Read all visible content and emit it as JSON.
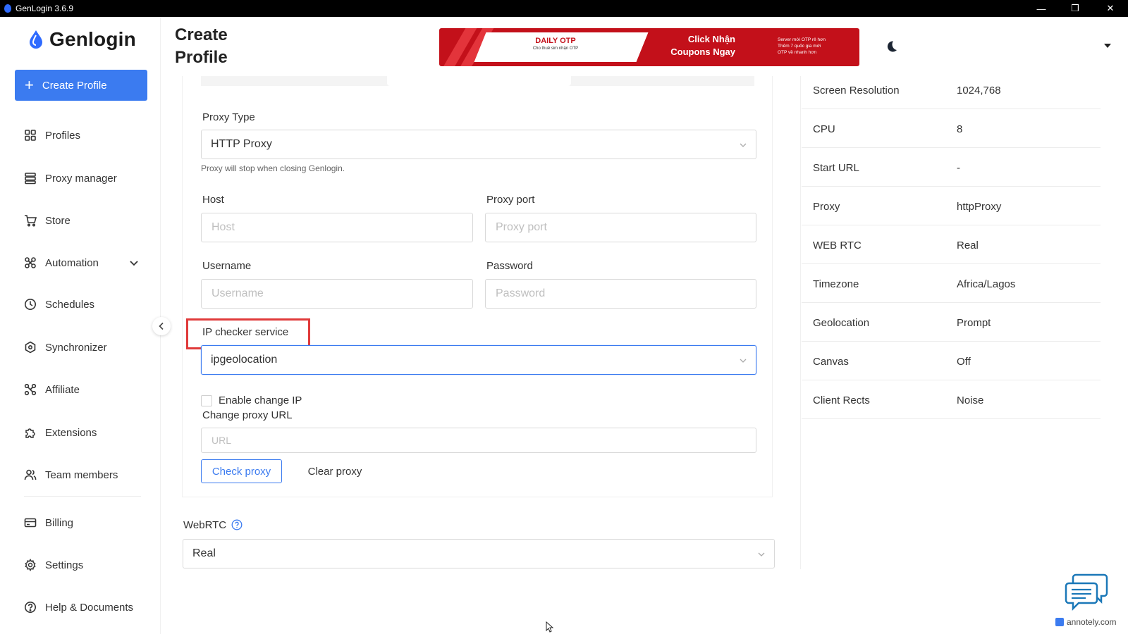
{
  "window": {
    "title": "GenLogin 3.6.9"
  },
  "brand": {
    "name": "Genlogin",
    "accent": "#3b7bf0"
  },
  "sidebar": {
    "create_label": "Create Profile",
    "items": [
      {
        "label": "Profiles",
        "icon": "grid-icon"
      },
      {
        "label": "Proxy manager",
        "icon": "server-icon"
      },
      {
        "label": "Store",
        "icon": "cart-icon"
      },
      {
        "label": "Automation",
        "icon": "automation-icon"
      },
      {
        "label": "Schedules",
        "icon": "clock-icon"
      },
      {
        "label": "Synchronizer",
        "icon": "sync-icon"
      },
      {
        "label": "Affiliate",
        "icon": "affiliate-icon"
      },
      {
        "label": "Extensions",
        "icon": "puzzle-icon"
      },
      {
        "label": "Team members",
        "icon": "team-icon"
      },
      {
        "label": "Billing",
        "icon": "card-icon"
      },
      {
        "label": "Settings",
        "icon": "gear-icon"
      },
      {
        "label": "Help & Documents",
        "icon": "help-icon"
      }
    ]
  },
  "header": {
    "title_line1": "Create",
    "title_line2": "Profile"
  },
  "banner": {
    "brand": "DAILY OTP",
    "tagline": "Cho thuê sim nhận OTP",
    "cta_line1": "Click Nhận",
    "cta_line2": "Coupons Ngay",
    "bullets": [
      "Server mới OTP rẻ hơn",
      "Thêm 7 quốc gia mới",
      "OTP về nhanh hơn"
    ]
  },
  "form": {
    "proxy_type_label": "Proxy Type",
    "proxy_type_value": "HTTP Proxy",
    "proxy_help": "Proxy will stop when closing Genlogin.",
    "host_label": "Host",
    "host_placeholder": "Host",
    "port_label": "Proxy port",
    "port_placeholder": "Proxy port",
    "username_label": "Username",
    "username_placeholder": "Username",
    "password_label": "Password",
    "password_placeholder": "Password",
    "ip_checker_label": "IP checker service",
    "ip_checker_value": "ipgeolocation",
    "enable_change_ip_label": "Enable change IP",
    "change_proxy_url_label": "Change proxy URL",
    "url_placeholder": "URL",
    "check_proxy_label": "Check proxy",
    "clear_proxy_label": "Clear proxy",
    "webrtc_label": "WebRTC",
    "webrtc_value": "Real"
  },
  "overview": [
    {
      "key": "Screen Resolution",
      "value": "1024,768"
    },
    {
      "key": "CPU",
      "value": "8"
    },
    {
      "key": "Start URL",
      "value": "-"
    },
    {
      "key": "Proxy",
      "value": "httpProxy"
    },
    {
      "key": "WEB RTC",
      "value": "Real"
    },
    {
      "key": "Timezone",
      "value": "Africa/Lagos"
    },
    {
      "key": "Geolocation",
      "value": "Prompt"
    },
    {
      "key": "Canvas",
      "value": "Off"
    },
    {
      "key": "Client Rects",
      "value": "Noise"
    }
  ],
  "watermark": "annotely.com"
}
